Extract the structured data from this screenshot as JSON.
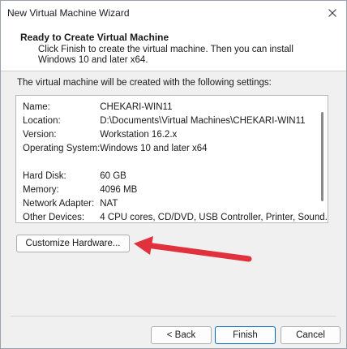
{
  "window": {
    "title": "New Virtual Machine Wizard"
  },
  "header": {
    "title": "Ready to Create Virtual Machine",
    "description": "Click Finish to create the virtual machine. Then you can install Windows 10 and later x64."
  },
  "intro_text": "The virtual machine will be created with the following settings:",
  "settings": [
    {
      "key": "Name:",
      "value": "CHEKARI-WIN11"
    },
    {
      "key": "Location:",
      "value": "D:\\Documents\\Virtual Machines\\CHEKARI-WIN11"
    },
    {
      "key": "Version:",
      "value": "Workstation 16.2.x"
    },
    {
      "key": "Operating System:",
      "value": "Windows 10 and later x64"
    },
    {
      "key": "Hard Disk:",
      "value": "60 GB"
    },
    {
      "key": "Memory:",
      "value": "4096 MB"
    },
    {
      "key": "Network Adapter:",
      "value": "NAT"
    },
    {
      "key": "Other Devices:",
      "value": "4 CPU cores, CD/DVD, USB Controller, Printer, Sound..."
    }
  ],
  "buttons": {
    "customize": "Customize Hardware...",
    "back": "< Back",
    "finish": "Finish",
    "cancel": "Cancel"
  },
  "colors": {
    "annotation_arrow": "#e0313c",
    "primary_border": "#0067c0"
  },
  "icons": {
    "close": "close-icon",
    "annotation": "red-arrow-annotation"
  }
}
